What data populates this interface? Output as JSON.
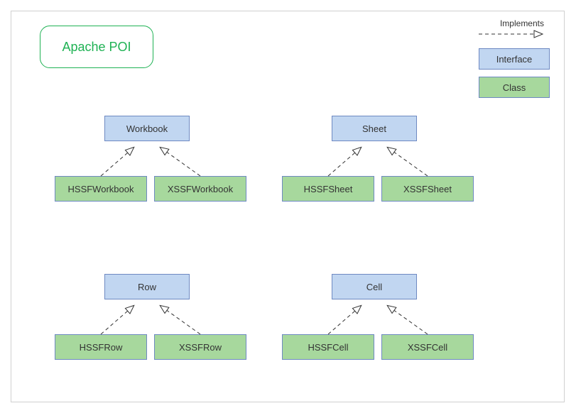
{
  "title": "Apache POI",
  "legend": {
    "implements": "Implements",
    "interface": "Interface",
    "class": "Class"
  },
  "groups": [
    {
      "interface": "Workbook",
      "implementations": [
        "HSSFWorkbook",
        "XSSFWorkbook"
      ]
    },
    {
      "interface": "Sheet",
      "implementations": [
        "HSSFSheet",
        "XSSFSheet"
      ]
    },
    {
      "interface": "Row",
      "implementations": [
        "HSSFRow",
        "XSSFRow"
      ]
    },
    {
      "interface": "Cell",
      "implementations": [
        "HSSFCell",
        "XSSFCell"
      ]
    }
  ]
}
